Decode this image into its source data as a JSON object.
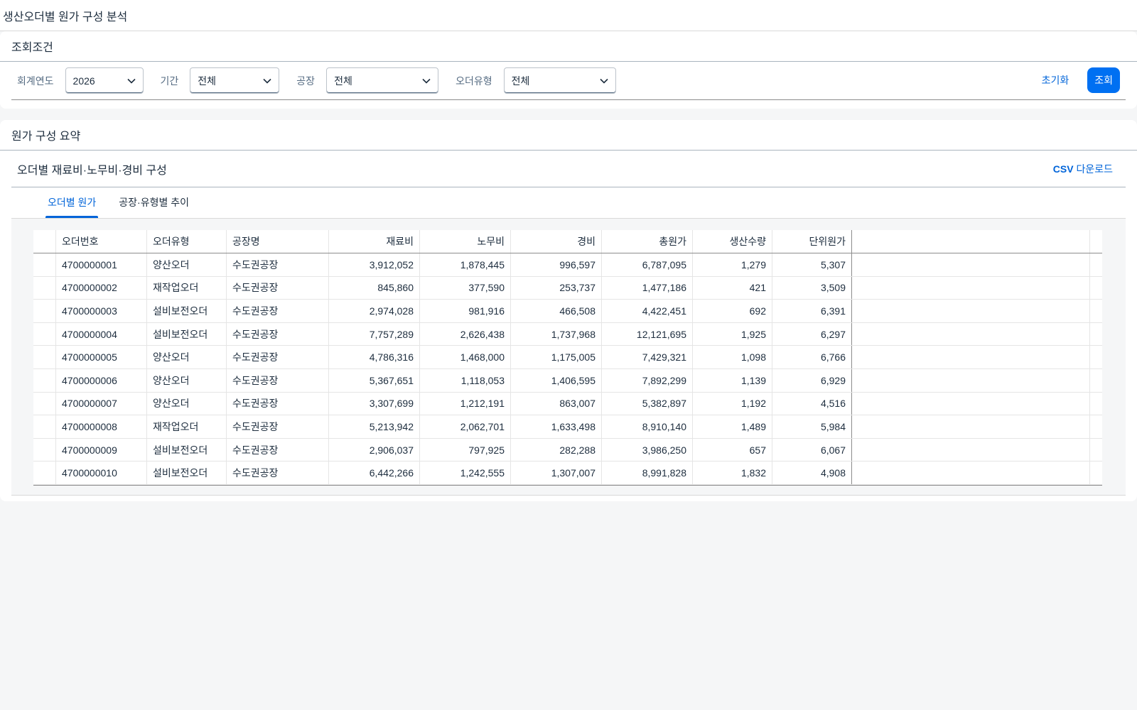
{
  "app": {
    "title": "생산오더별 원가 구성 분석"
  },
  "filters": {
    "header": "조회조건",
    "fiscal_year": {
      "label": "회계연도",
      "value": "2026"
    },
    "period": {
      "label": "기간",
      "value": "전체"
    },
    "plant": {
      "label": "공장",
      "value": "전체"
    },
    "order_type": {
      "label": "오더유형",
      "value": "전체"
    },
    "reset_label": "초기화",
    "search_label": "조회"
  },
  "summary": {
    "header": "원가 구성 요약",
    "card_title": "오더별 재료비·노무비·경비 구성",
    "csv_prefix": "CSV",
    "csv_suffix": " 다운로드",
    "tabs": [
      {
        "label": "오더별 원가"
      },
      {
        "label": "공장·유형별 추이"
      }
    ]
  },
  "table": {
    "columns": [
      "오더번호",
      "오더유형",
      "공장명",
      "재료비",
      "노무비",
      "경비",
      "총원가",
      "생산수량",
      "단위원가"
    ],
    "rows": [
      [
        "4700000001",
        "양산오더",
        "수도권공장",
        "3,912,052",
        "1,878,445",
        "996,597",
        "6,787,095",
        "1,279",
        "5,307"
      ],
      [
        "4700000002",
        "재작업오더",
        "수도권공장",
        "845,860",
        "377,590",
        "253,737",
        "1,477,186",
        "421",
        "3,509"
      ],
      [
        "4700000003",
        "설비보전오더",
        "수도권공장",
        "2,974,028",
        "981,916",
        "466,508",
        "4,422,451",
        "692",
        "6,391"
      ],
      [
        "4700000004",
        "설비보전오더",
        "수도권공장",
        "7,757,289",
        "2,626,438",
        "1,737,968",
        "12,121,695",
        "1,925",
        "6,297"
      ],
      [
        "4700000005",
        "양산오더",
        "수도권공장",
        "4,786,316",
        "1,468,000",
        "1,175,005",
        "7,429,321",
        "1,098",
        "6,766"
      ],
      [
        "4700000006",
        "양산오더",
        "수도권공장",
        "5,367,651",
        "1,118,053",
        "1,406,595",
        "7,892,299",
        "1,139",
        "6,929"
      ],
      [
        "4700000007",
        "양산오더",
        "수도권공장",
        "3,307,699",
        "1,212,191",
        "863,007",
        "5,382,897",
        "1,192",
        "4,516"
      ],
      [
        "4700000008",
        "재작업오더",
        "수도권공장",
        "5,213,942",
        "2,062,701",
        "1,633,498",
        "8,910,140",
        "1,489",
        "5,984"
      ],
      [
        "4700000009",
        "설비보전오더",
        "수도권공장",
        "2,906,037",
        "797,925",
        "282,288",
        "3,986,250",
        "657",
        "6,067"
      ],
      [
        "4700000010",
        "설비보전오더",
        "수도권공장",
        "6,442,266",
        "1,242,555",
        "1,307,007",
        "8,991,828",
        "1,832",
        "4,908"
      ]
    ]
  },
  "colors": {
    "accent": "#0070f2",
    "link": "#0064d9",
    "text": "#1d2d3e",
    "background": "#f5f6f7"
  },
  "icons": {
    "select_chevron": "chevron-down-icon"
  }
}
